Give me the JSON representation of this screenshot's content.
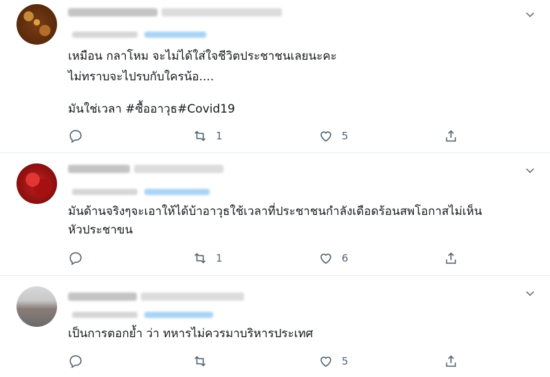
{
  "tweets": [
    {
      "text_line1": "เหมือน กลาโหม จะไม่ได้ใส่ใจชีวิตประชาชนเลยนะคะ",
      "text_line2": "ไม่ทราบจะไปรบกับใครน้อ....",
      "text_line3": "",
      "text_line4": "มันใช่เวลา #ซื้ออาวุธ#Covid19",
      "retweets": "1",
      "likes": "5"
    },
    {
      "text_line1": "มันด้านจริงๆจะเอาให้ได้บ้าอาวุธใช้เวลาที่ประชาชนกำลังเดือดร้อนสพโอกาสไม่เห็น",
      "text_line2": "หัวประชาขน",
      "retweets": "1",
      "likes": "6"
    },
    {
      "text_line1": "เป็นการตอกย้ำ ว่า ทหารไม่ควรมาบริหารประเทศ",
      "retweets": "",
      "likes": "5"
    }
  ],
  "icons": {
    "menu": "chevron-down-icon",
    "reply": "reply-icon",
    "retweet": "retweet-icon",
    "like": "heart-icon",
    "share": "share-icon"
  },
  "colors": {
    "icon": "#536471",
    "divider": "#e6ecf0",
    "link": "#1da1f2"
  }
}
